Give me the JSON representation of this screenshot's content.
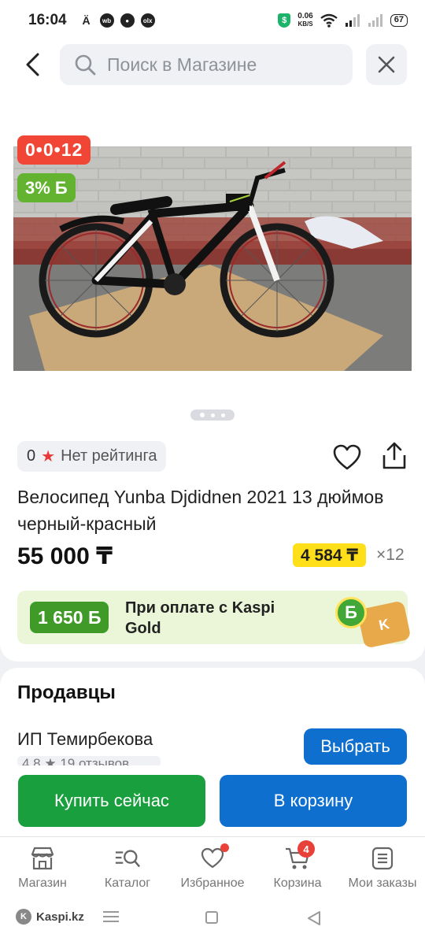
{
  "status_bar": {
    "time": "16:04",
    "net_speed_value": "0.06",
    "net_speed_unit": "KB/S",
    "battery": "67"
  },
  "header": {
    "search_placeholder": "Поиск в Магазине"
  },
  "product": {
    "promo_installment_badge": "0•0•12",
    "bonus_badge": "3% Б",
    "rating_value": "0",
    "rating_text": "Нет рейтинга",
    "title": "Велосипед Yunba Djdidnen 2021 13 дюймов черный-красный",
    "price": "55 000 ₸",
    "installment_price": "4 584 ₸",
    "installment_months": "×12",
    "image_count": 3,
    "active_image_index": 0
  },
  "kaspi_gold": {
    "bonus_amount": "1 650 Б",
    "text": "При оплате с Kaspi Gold",
    "coin_letter": "Б"
  },
  "sellers": {
    "title": "Продавцы",
    "items": [
      {
        "name": "ИП Темирбекова",
        "rating": "4.8 ★ 19 отзывов",
        "choose_label": "Выбрать"
      }
    ]
  },
  "actions": {
    "buy_now": "Купить сейчас",
    "add_to_cart": "В корзину"
  },
  "bottom_nav": {
    "items": [
      {
        "label": "Магазин",
        "icon": "shop-icon"
      },
      {
        "label": "Каталог",
        "icon": "catalog-search-icon"
      },
      {
        "label": "Избранное",
        "icon": "heart-icon",
        "dot": true
      },
      {
        "label": "Корзина",
        "icon": "cart-icon",
        "count": "4"
      },
      {
        "label": "Мои заказы",
        "icon": "orders-icon"
      }
    ]
  },
  "system": {
    "brand": "Kaspi.kz"
  },
  "colors": {
    "primary_blue": "#0e6fce",
    "buy_green": "#199f3e",
    "promo_red": "#f14635",
    "bonus_green": "#63b331",
    "installment_yellow": "#ffdf1a"
  }
}
